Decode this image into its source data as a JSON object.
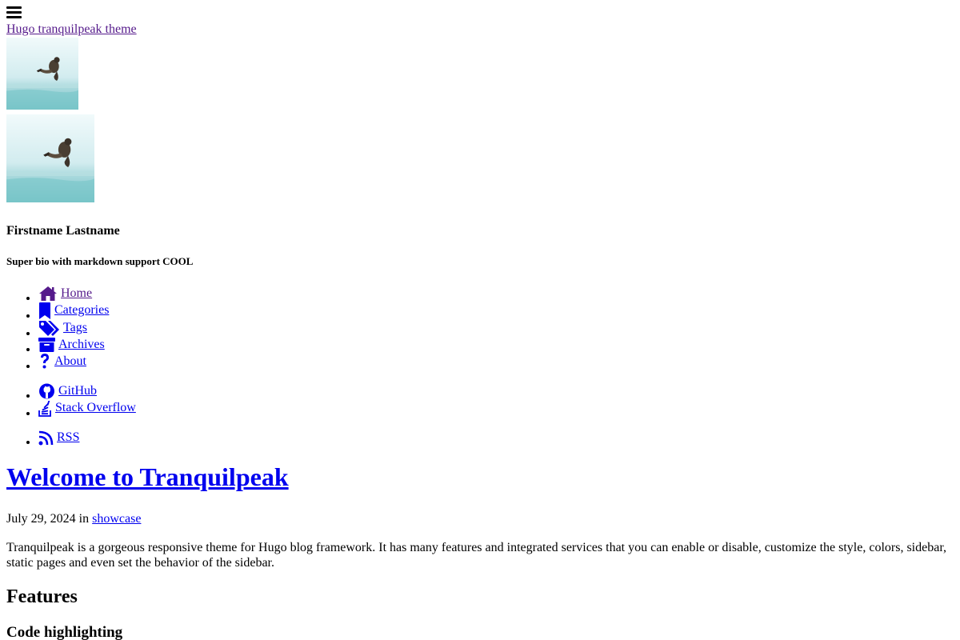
{
  "header": {
    "menu_icon": "hamburger-menu-icon",
    "site_title": "Hugo tranquilpeak theme"
  },
  "sidebar": {
    "author_name": "Firstname Lastname",
    "author_bio": "Super bio with markdown support COOL",
    "photo_alt": "author-photo",
    "nav": [
      {
        "label": "Home",
        "icon": "home-icon"
      },
      {
        "label": "Categories",
        "icon": "bookmark-icon"
      },
      {
        "label": "Tags",
        "icon": "tags-icon"
      },
      {
        "label": "Archives",
        "icon": "archive-icon"
      },
      {
        "label": "About",
        "icon": "question-icon"
      }
    ],
    "social": [
      {
        "label": "GitHub",
        "icon": "github-icon"
      },
      {
        "label": "Stack Overflow",
        "icon": "stack-overflow-icon"
      }
    ],
    "feeds": [
      {
        "label": "RSS",
        "icon": "rss-icon"
      }
    ]
  },
  "post": {
    "title": "Welcome to Tranquilpeak",
    "date": "July 29, 2024",
    "in_word": "in",
    "category": "showcase",
    "intro": "Tranquilpeak is a gorgeous responsive theme for Hugo blog framework. It has many features and integrated services that you can enable or disable, customize the style, colors, sidebar, static pages and even set the behavior of the sidebar.",
    "heading_features": "Features",
    "heading_code": "Code highlighting"
  },
  "colors": {
    "link": "#0000ee",
    "visited_link": "#551a8b",
    "text": "#000000",
    "background": "#ffffff"
  }
}
